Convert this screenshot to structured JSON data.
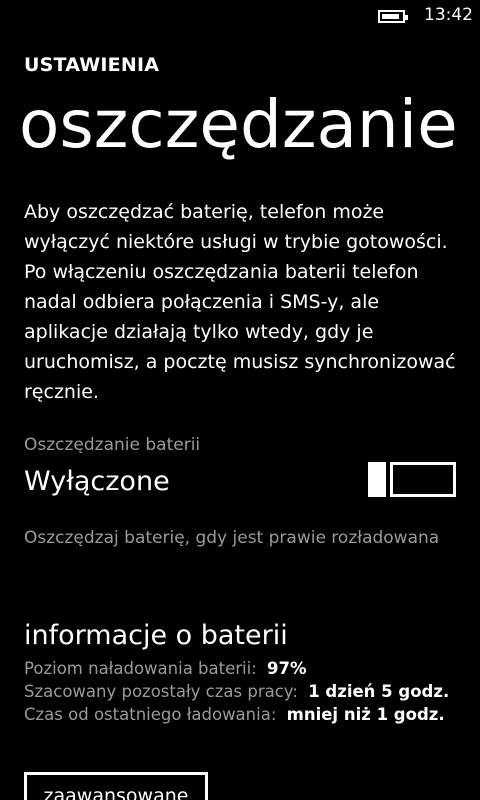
{
  "status_bar": {
    "time": "13:42",
    "battery_level": 0.9
  },
  "header": {
    "app_title": "USTAWIENIA",
    "page_title": "oszczędzanie baterii"
  },
  "description": "Aby oszczędzać baterię, telefon może wyłączyć niektóre usługi w trybie gotowości. Po włączeniu oszczędzania baterii telefon nadal odbiera połączenia i SMS-y, ale aplikacje działają tylko wtedy, gdy je uruchomisz, a pocztę musisz synchronizować ręcznie.",
  "battery_saver": {
    "label": "Oszczędzanie baterii",
    "value": "Wyłączone",
    "enabled": false
  },
  "auto_option": "Oszczędzaj baterię, gdy jest prawie rozładowana",
  "battery_info": {
    "heading": "informacje o baterii",
    "rows": [
      {
        "label": "Poziom naładowania baterii:",
        "value": "97%"
      },
      {
        "label": "Szacowany pozostały czas pracy:",
        "value": "1 dzień 5 godz."
      },
      {
        "label": "Czas od ostatniego ładowania:",
        "value": "mniej niż 1 godz."
      }
    ]
  },
  "buttons": {
    "advanced": "zaawansowane"
  }
}
